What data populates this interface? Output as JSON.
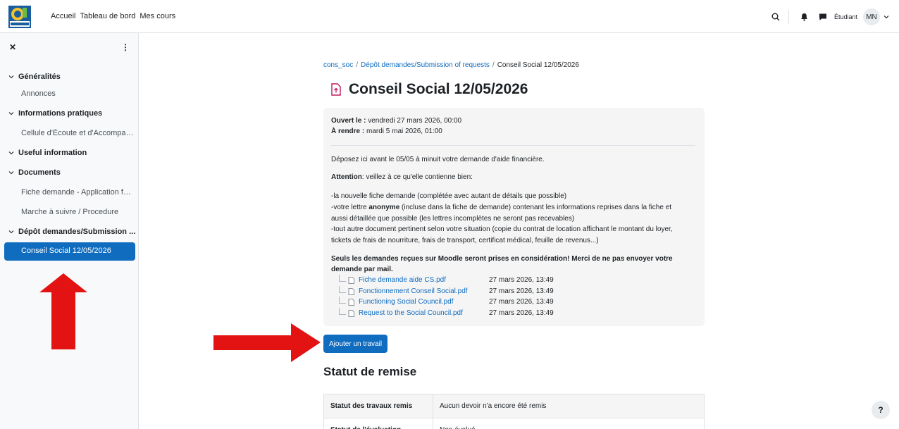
{
  "nav": {
    "items": [
      "Accueil",
      "Tableau de bord",
      "Mes cours"
    ]
  },
  "header": {
    "role": "Étudiant",
    "avatar_initials": "MN"
  },
  "sidebar": {
    "sections": [
      {
        "label": "Généralités",
        "children": [
          "Annonces"
        ]
      },
      {
        "label": "Informations pratiques",
        "children": [
          "Cellule d'Écoute et d'Accompag..."
        ]
      },
      {
        "label": "Useful information",
        "children": []
      },
      {
        "label": "Documents",
        "children": [
          "Fiche demande - Application for...",
          "Marche à suivre / Procedure"
        ]
      },
      {
        "label": "Dépôt demandes/Submission ...",
        "children": []
      }
    ],
    "active_item": "Conseil Social 12/05/2026"
  },
  "breadcrumb": {
    "course": "cons_soc",
    "section": "Dépôt demandes/Submission of requests",
    "current": "Conseil Social 12/05/2026"
  },
  "page": {
    "title": "Conseil Social 12/05/2026"
  },
  "dates": {
    "opened_label": "Ouvert le :",
    "opened_value": "vendredi 27 mars 2026, 00:00",
    "due_label": "À rendre :",
    "due_value": "mardi 5 mai 2026, 01:00"
  },
  "description": {
    "intro": "Déposez ici avant le 05/05 à minuit votre demande d'aide financière.",
    "attention_label": "Attention",
    "attention_text": ": veillez à ce qu'elle contienne bien:",
    "bullet1": "-la nouvelle fiche demande (complétée avec autant de détails que possible)",
    "bullet2_pre": "-votre lettre ",
    "bullet2_bold": "anonyme",
    "bullet2_post": " (incluse dans la fiche de demande) contenant les informations reprises dans la fiche et",
    "bullet2_line2": "aussi détaillée que possible (les lettres incomplètes ne seront pas recevables)",
    "bullet3_line1": "-tout autre document pertinent selon votre situation (copie du contrat de location affichant le montant du loyer,",
    "bullet3_line2": "tickets de frais de nourriture, frais de transport, certificat médical, feuille de revenus...)",
    "warning_line1": "Seuls les demandes reçues sur Moodle seront prises en considération! Merci de ne pas envoyer votre",
    "warning_line2": "demande par mail."
  },
  "files": [
    {
      "name": "Fiche demande aide CS.pdf",
      "date": "27 mars 2026, 13:49"
    },
    {
      "name": "Fonctionnement Conseil Social.pdf",
      "date": "27 mars 2026, 13:49"
    },
    {
      "name": "Functioning Social Council.pdf",
      "date": "27 mars 2026, 13:49"
    },
    {
      "name": "Request to the Social Council.pdf",
      "date": "27 mars 2026, 13:49"
    }
  ],
  "add_button": "Ajouter un travail",
  "status": {
    "heading": "Statut de remise",
    "rows": [
      {
        "label": "Statut des travaux remis",
        "value": "Aucun devoir n'a encore été remis"
      },
      {
        "label": "Statut de l'évaluation",
        "value": "Non évalué"
      }
    ]
  },
  "help_label": "?",
  "colors": {
    "primary": "#0f6cbf",
    "annotation_arrow": "#e31313",
    "file_icon": "#c2185b"
  }
}
